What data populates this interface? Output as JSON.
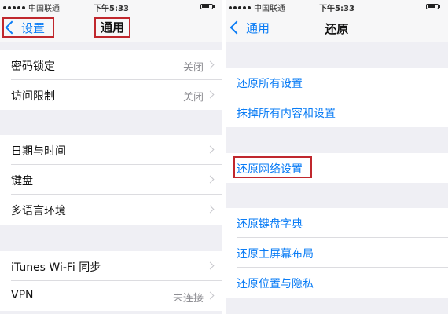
{
  "left": {
    "status": {
      "carrier": "中国联通",
      "time": "下午5:33"
    },
    "nav": {
      "back_label": "设置",
      "title": "通用"
    },
    "group1": [
      {
        "label": "密码锁定",
        "value": "关闭"
      },
      {
        "label": "访问限制",
        "value": "关闭"
      }
    ],
    "group2": [
      {
        "label": "日期与时间"
      },
      {
        "label": "键盘"
      },
      {
        "label": "多语言环境"
      }
    ],
    "group3": [
      {
        "label": "iTunes Wi-Fi 同步"
      },
      {
        "label": "VPN",
        "value": "未连接"
      }
    ]
  },
  "right": {
    "status": {
      "carrier": "中国联通",
      "time": "下午5:33"
    },
    "nav": {
      "back_label": "通用",
      "title": "还原"
    },
    "group1": [
      {
        "label": "还原所有设置"
      },
      {
        "label": "抹掉所有内容和设置"
      }
    ],
    "group2": [
      {
        "label": "还原网络设置"
      }
    ],
    "group3": [
      {
        "label": "还原键盘字典"
      },
      {
        "label": "还原主屏幕布局"
      },
      {
        "label": "还原位置与隐私"
      }
    ]
  },
  "colors": {
    "accent": "#0a7cf5",
    "highlight": "#c0272d",
    "background": "#efeff4"
  }
}
